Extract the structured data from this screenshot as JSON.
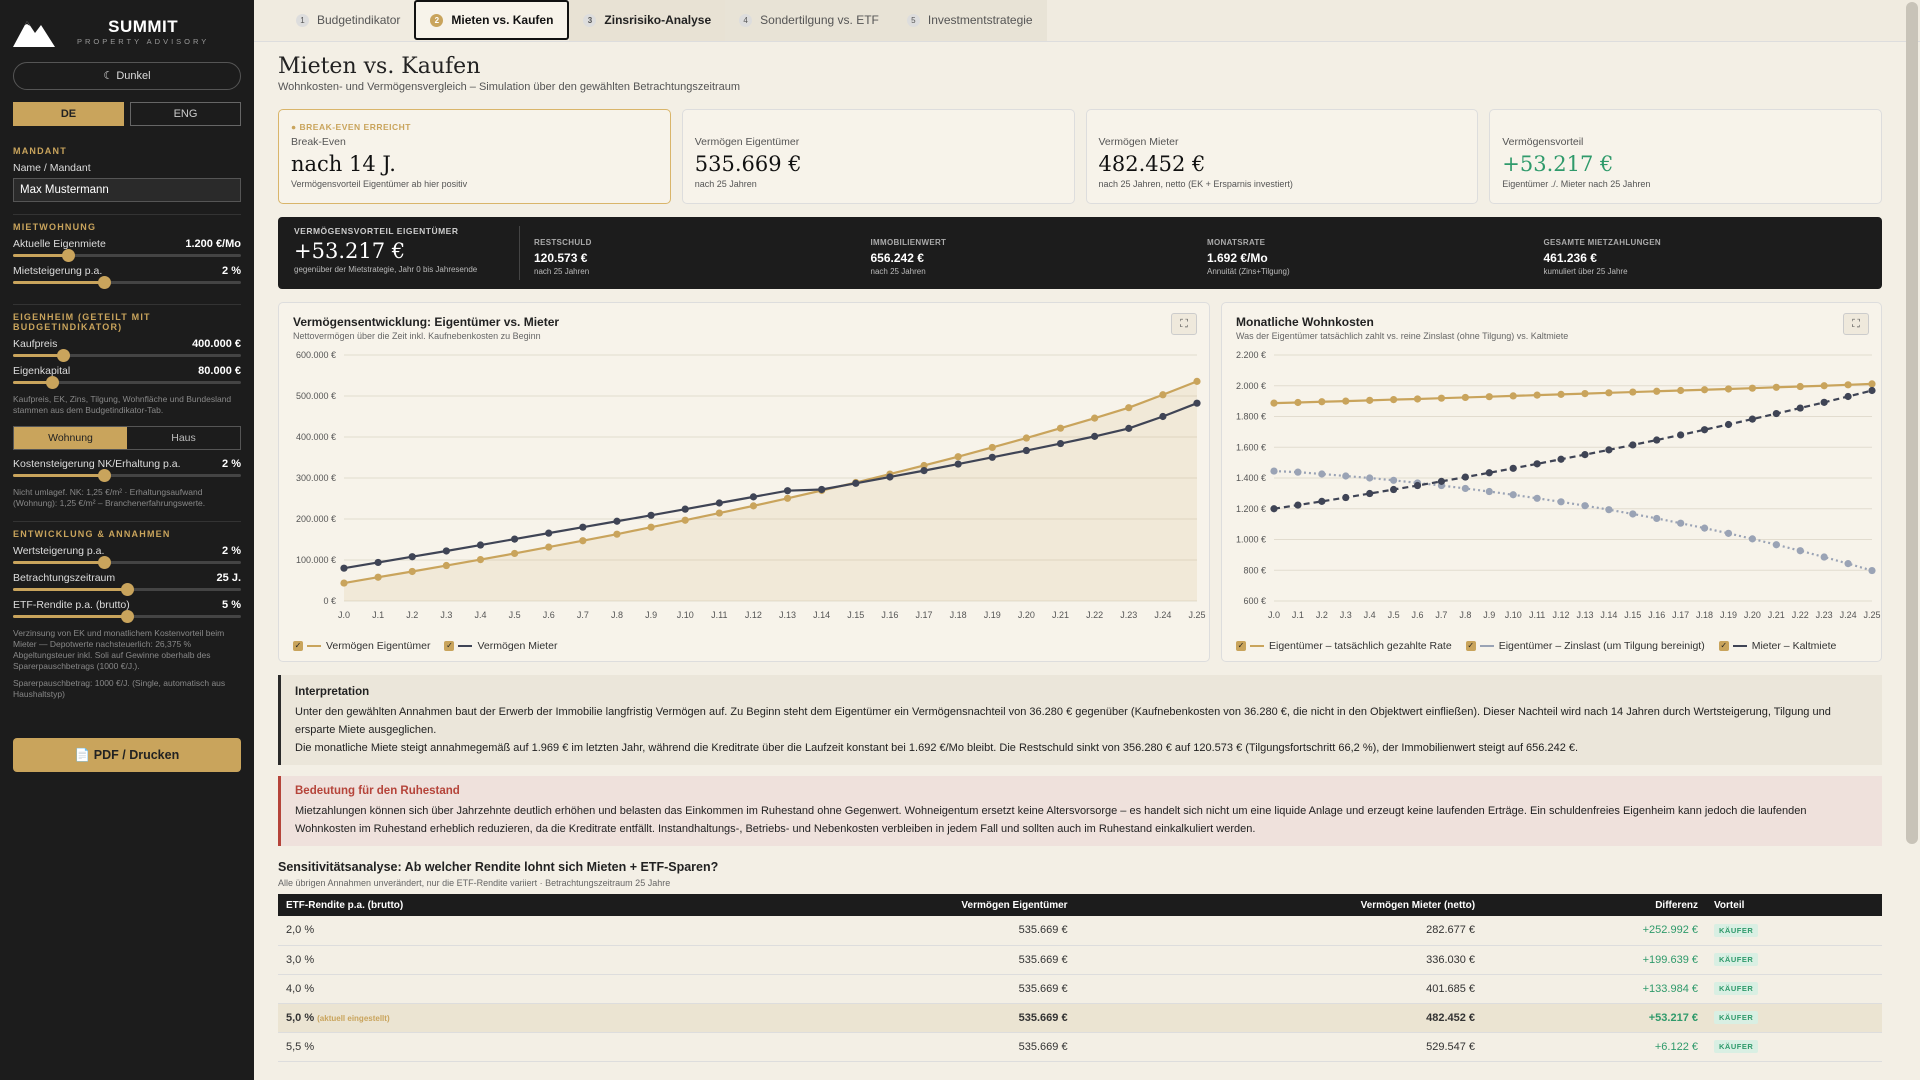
{
  "brand": {
    "name": "SUMMIT",
    "tagline": "PROPERTY ADVISORY"
  },
  "sidebar": {
    "theme_label": "☾ Dunkel",
    "lang": [
      "DE",
      "ENG"
    ],
    "client_title": "MANDANT",
    "client_label": "Name / Mandant",
    "client_value": "Max Mustermann",
    "rent_title": "MIETWOHNUNG",
    "rent_label": "Aktuelle Eigenmiete",
    "rent_value": "1.200 €/Mo",
    "rent_level": 0.24,
    "rent_inc_label": "Mietsteigerung p.a.",
    "rent_inc_value": "2 %",
    "rent_inc_level": 0.4,
    "own_title": "EIGENHEIM (GETEILT MIT BUDGETINDIKATOR)",
    "price_label": "Kaufpreis",
    "price_value": "400.000 €",
    "price_level": 0.22,
    "equity_label": "Eigenkapital",
    "equity_value": "80.000 €",
    "equity_level": 0.17,
    "own_note": "Kaufpreis, EK, Zins, Tilgung, Wohnfläche und Bundesland stammen aus dem Budgetindikator-Tab.",
    "type_opts": [
      "Wohnung",
      "Haus"
    ],
    "cost_inc_label": "Kostensteigerung NK/Erhaltung p.a.",
    "cost_inc_value": "2 %",
    "cost_inc_level": 0.4,
    "cost_note": "Nicht umlagef. NK: 1,25 €/m² · Erhaltungsaufwand (Wohnung): 1,25 €/m² – Branchenerfahrungswerte.",
    "dev_title": "ENTWICKLUNG & ANNAHMEN",
    "apprec_label": "Wertsteigerung p.a.",
    "apprec_value": "2 %",
    "apprec_level": 0.4,
    "period_label": "Betrachtungszeitraum",
    "period_value": "25 J.",
    "period_level": 0.5,
    "etf_label": "ETF-Rendite p.a. (brutto)",
    "etf_value": "5 %",
    "etf_level": 0.5,
    "etf_note": "Verzinsung von EK und monatlichem Kostenvorteil beim Mieter — Depotwerte nachsteuerlich: 26,375 % Abgeltungsteuer inkl. Soli auf Gewinne oberhalb des Sparerpauschbetrags (1000 €/J.).",
    "etf_note2": "Sparerpauschbetrag: 1000 €/J. (Single, automatisch aus Haushaltstyp)",
    "pdf_label": "📄 PDF / Drucken"
  },
  "tabs": [
    {
      "num": "1",
      "label": "Budgetindikator"
    },
    {
      "num": "2",
      "label": "Mieten vs. Kaufen"
    },
    {
      "num": "3",
      "label": "Zinsrisiko-Analyse"
    },
    {
      "num": "4",
      "label": "Sondertilgung vs. ETF"
    },
    {
      "num": "5",
      "label": "Investmentstrategie"
    }
  ],
  "page": {
    "title": "Mieten vs. Kaufen",
    "subtitle": "Wohnkosten- und Vermögensvergleich – Simulation über den gewählten Betrachtungszeitraum"
  },
  "cards": [
    {
      "badge": "● BREAK-EVEN ERREICHT",
      "label": "Break-Even",
      "value": "nach 14 J.",
      "sub": "Vermögensvorteil Eigentümer ab hier positiv"
    },
    {
      "badge": "",
      "label": "Vermögen Eigentümer",
      "value": "535.669 €",
      "sub": "nach 25 Jahren"
    },
    {
      "badge": "",
      "label": "Vermögen Mieter",
      "value": "482.452 €",
      "sub": "nach 25 Jahren, netto (EK + Ersparnis investiert)"
    },
    {
      "badge": "",
      "label": "Vermögensvorteil",
      "value": "+53.217 €",
      "sub": "Eigentümer ./. Mieter nach 25 Jahren"
    }
  ],
  "summary": {
    "main_label": "VERMÖGENSVORTEIL EIGENTÜMER",
    "main_value": "+53.217 €",
    "main_sub": "gegenüber der Mietstrategie, Jahr 0 bis Jahresende",
    "items": [
      {
        "label": "RESTSCHULD",
        "value": "120.573 €",
        "sub": "nach 25 Jahren"
      },
      {
        "label": "IMMOBILIENWERT",
        "value": "656.242 €",
        "sub": "nach 25 Jahren"
      },
      {
        "label": "MONATSRATE",
        "value": "1.692 €/Mo",
        "sub": "Annuität (Zins+Tilgung)"
      },
      {
        "label": "GESAMTE MIETZAHLUNGEN",
        "value": "461.236 €",
        "sub": "kumuliert über 25 Jahre"
      }
    ]
  },
  "chart1": {
    "title": "Vermögensentwicklung: Eigentümer vs. Mieter",
    "subtitle": "Nettovermögen über die Zeit inkl. Kaufnebenkosten zu Beginn"
  },
  "chart2": {
    "title": "Monatliche Wohnkosten",
    "subtitle": "Was der Eigentümer tatsächlich zahlt vs. reine Zinslast (ohne Tilgung) vs. Kaltmiete"
  },
  "chart_data": [
    {
      "type": "line",
      "title": "Vermögensentwicklung: Eigentümer vs. Mieter",
      "x": [
        "J.0",
        "J.1",
        "J.2",
        "J.3",
        "J.4",
        "J.5",
        "J.6",
        "J.7",
        "J.8",
        "J.9",
        "J.10",
        "J.11",
        "J.12",
        "J.13",
        "J.14",
        "J.15",
        "J.16",
        "J.17",
        "J.18",
        "J.19",
        "J.20",
        "J.21",
        "J.22",
        "J.23",
        "J.24",
        "J.25"
      ],
      "ylim": [
        0,
        600000
      ],
      "yticks": [
        "0 €",
        "100.000 €",
        "200.000 €",
        "300.000 €",
        "400.000 €",
        "500.000 €",
        "600.000 €"
      ],
      "series": [
        {
          "name": "Vermögen Eigentümer",
          "color": "#c9a45c",
          "dash": "",
          "values": [
            43720,
            58000,
            72000,
            86500,
            101000,
            116000,
            131500,
            147000,
            163000,
            180000,
            197000,
            214500,
            232000,
            250500,
            269500,
            289000,
            309500,
            330500,
            352000,
            374500,
            397500,
            421500,
            446000,
            471500,
            503000,
            535669
          ]
        },
        {
          "name": "Vermögen Mieter",
          "color": "#3f4455",
          "dash": "",
          "values": [
            80000,
            94000,
            108000,
            122000,
            136500,
            151000,
            165500,
            180000,
            194500,
            209000,
            224000,
            239000,
            254000,
            269000,
            272000,
            287000,
            302500,
            318000,
            334000,
            350500,
            367000,
            384000,
            401500,
            421000,
            450000,
            482452
          ]
        }
      ]
    },
    {
      "type": "line",
      "title": "Monatliche Wohnkosten",
      "x": [
        "J.0",
        "J.1",
        "J.2",
        "J.3",
        "J.4",
        "J.5",
        "J.6",
        "J.7",
        "J.8",
        "J.9",
        "J.10",
        "J.11",
        "J.12",
        "J.13",
        "J.14",
        "J.15",
        "J.16",
        "J.17",
        "J.18",
        "J.19",
        "J.20",
        "J.21",
        "J.22",
        "J.23",
        "J.24",
        "J.25"
      ],
      "ylim": [
        600,
        2200
      ],
      "yticks": [
        "600 €",
        "800 €",
        "1.000 €",
        "1.200 €",
        "1.400 €",
        "1.600 €",
        "1.800 €",
        "2.000 €",
        "2.200 €"
      ],
      "series": [
        {
          "name": "Eigentümer – tatsächlich gezahlte Rate",
          "color": "#c9a45c",
          "dash": "",
          "values": [
            1887,
            1891,
            1896,
            1900,
            1905,
            1910,
            1914,
            1919,
            1924,
            1929,
            1934,
            1939,
            1944,
            1949,
            1954,
            1959,
            1964,
            1969,
            1974,
            1979,
            1984,
            1990,
            1995,
            2000,
            2006,
            2012
          ]
        },
        {
          "name": "Eigentümer – Zinslast (um Tilgung bereinigt)",
          "color": "#9aa3b5",
          "dash": "2,3",
          "values": [
            1445,
            1438,
            1426,
            1413,
            1400,
            1385,
            1368,
            1351,
            1332,
            1312,
            1291,
            1268,
            1245,
            1220,
            1194,
            1166,
            1137,
            1106,
            1074,
            1040,
            1004,
            966,
            927,
            886,
            843,
            798
          ]
        },
        {
          "name": "Mieter – Kaltmiete",
          "color": "#3f4455",
          "dash": "6,4",
          "values": [
            1200,
            1224,
            1248,
            1273,
            1299,
            1325,
            1351,
            1378,
            1406,
            1434,
            1463,
            1492,
            1522,
            1552,
            1583,
            1615,
            1647,
            1680,
            1714,
            1748,
            1783,
            1819,
            1855,
            1892,
            1930,
            1969
          ]
        }
      ]
    }
  ],
  "interpretation": {
    "title": "Interpretation",
    "line1": "Unter den gewählten Annahmen baut der Erwerb der Immobilie langfristig Vermögen auf. Zu Beginn steht dem Eigentümer ein Vermögensnachteil von 36.280 € gegenüber (Kaufnebenkosten von 36.280 €, die nicht in den Objektwert einfließen). Dieser Nachteil wird nach 14 Jahren durch Wertsteigerung, Tilgung und ersparte Miete ausgeglichen.",
    "line2": "Die monatliche Miete steigt annahmegemäß auf 1.969 € im letzten Jahr, während die Kreditrate über die Laufzeit konstant bei 1.692 €/Mo bleibt. Die Restschuld sinkt von 356.280 € auf 120.573 € (Tilgungsfortschritt 66,2 %), der Immobilienwert steigt auf 656.242 €."
  },
  "retirement": {
    "title": "Bedeutung für den Ruhestand",
    "text": "Mietzahlungen können sich über Jahrzehnte deutlich erhöhen und belasten das Einkommen im Ruhestand ohne Gegenwert. Wohneigentum ersetzt keine Altersvorsorge – es handelt sich nicht um eine liquide Anlage und erzeugt keine laufenden Erträge. Ein schuldenfreies Eigenheim kann jedoch die laufenden Wohnkosten im Ruhestand erheblich reduzieren, da die Kreditrate entfällt. Instandhaltungs-, Betriebs- und Nebenkosten verbleiben in jedem Fall und sollten auch im Ruhestand einkalkuliert werden."
  },
  "sensitivity": {
    "title": "Sensitivitätsanalyse: Ab welcher Rendite lohnt sich Mieten + ETF-Sparen?",
    "subtitle": "Alle übrigen Annahmen unverändert, nur die ETF-Rendite variiert · Betrachtungszeitraum 25 Jahre",
    "headers": [
      "ETF-Rendite p.a. (brutto)",
      "Vermögen Eigentümer",
      "Vermögen Mieter (netto)",
      "Differenz",
      "Vorteil"
    ],
    "current_note": "(aktuell eingestellt)",
    "rows": [
      {
        "rate": "2,0 %",
        "own": "535.669 €",
        "rent": "282.677 €",
        "diff": "+252.992 €",
        "verdict": "KÄUFER",
        "current": false
      },
      {
        "rate": "3,0 %",
        "own": "535.669 €",
        "rent": "336.030 €",
        "diff": "+199.639 €",
        "verdict": "KÄUFER",
        "current": false
      },
      {
        "rate": "4,0 %",
        "own": "535.669 €",
        "rent": "401.685 €",
        "diff": "+133.984 €",
        "verdict": "KÄUFER",
        "current": false
      },
      {
        "rate": "5,0 %",
        "own": "535.669 €",
        "rent": "482.452 €",
        "diff": "+53.217 €",
        "verdict": "KÄUFER",
        "current": true
      },
      {
        "rate": "5,5 %",
        "own": "535.669 €",
        "rent": "529.547 €",
        "diff": "+6.122 €",
        "verdict": "KÄUFER",
        "current": false
      }
    ]
  }
}
